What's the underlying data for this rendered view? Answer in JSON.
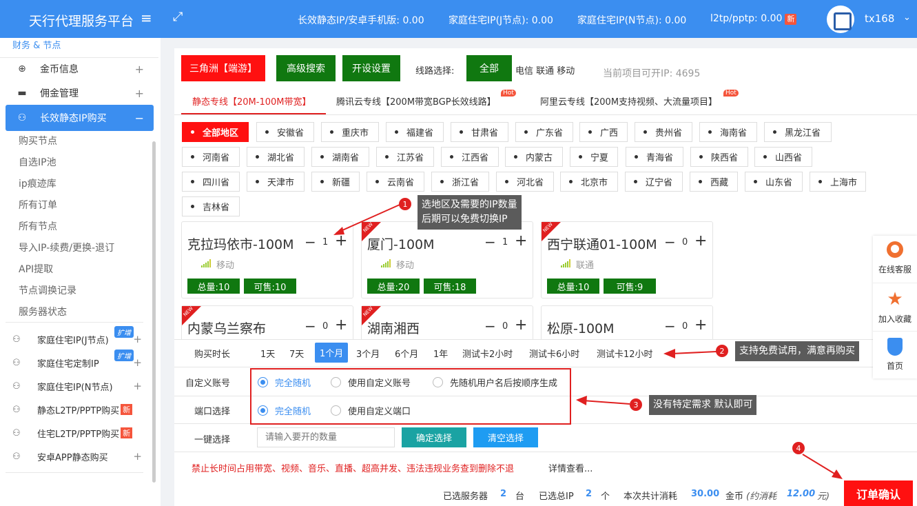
{
  "header": {
    "brand": "天行代理服务平台",
    "stats": [
      "长效静态IP/安卓手机版: 0.00",
      "家庭住宅IP(J节点): 0.00",
      "家庭住宅IP(N节点): 0.00",
      "l2tp/pptp: 0.00"
    ],
    "new_badge": "新",
    "username": "tx168"
  },
  "sidebar": {
    "top_label": "财务 & 节点",
    "gold": "金币信息",
    "commission": "佣金管理",
    "static_ip": "长效静态IP购买",
    "sub_items": [
      "购买节点",
      "自选IP池",
      "ip痕迹库",
      "所有订单",
      "所有节点",
      "导入IP-续费/更换-退订",
      "API提取",
      "节点调换记录",
      "服务器状态"
    ],
    "items2": [
      {
        "label": "家庭住宅IP(J节点)",
        "tag": "扩增"
      },
      {
        "label": "家庭住宅定制IP",
        "tag": "扩增"
      },
      {
        "label": "家庭住宅IP(N节点)",
        "tag": ""
      },
      {
        "label": "静态L2TP/PPTP购买",
        "tag": "新"
      },
      {
        "label": "住宅L2TP/PPTP购买",
        "tag": "新"
      },
      {
        "label": "安卓APP静态购买",
        "tag": ""
      }
    ]
  },
  "toolbar": {
    "sanjiaozhou": "三角洲【端游】",
    "advanced": "高级搜索",
    "settings": "开设设置",
    "line_label": "线路选择:",
    "all": "全部",
    "isps": "电信 联通 移动",
    "current": "当前项目可开IP: 4695"
  },
  "tabs": [
    {
      "label": "静态专线【20M-100M带宽】",
      "hot": ""
    },
    {
      "label": "腾讯云专线【200M带宽BGP长效线路】",
      "hot": "Hot"
    },
    {
      "label": "阿里云专线【200M支持视频、大流量项目】",
      "hot": "Hot"
    }
  ],
  "regions": [
    "全部地区",
    "安徽省",
    "重庆市",
    "福建省",
    "甘肃省",
    "广东省",
    "广西",
    "贵州省",
    "海南省",
    "黑龙江省",
    "河南省",
    "湖北省",
    "湖南省",
    "江苏省",
    "江西省",
    "内蒙古",
    "宁夏",
    "青海省",
    "陕西省",
    "山西省",
    "四川省",
    "天津市",
    "新疆",
    "云南省",
    "浙江省",
    "河北省",
    "北京市",
    "辽宁省",
    "西藏",
    "山东省",
    "上海市",
    "吉林省"
  ],
  "cards": [
    {
      "name": "克拉玛依市-100M",
      "qty": "1",
      "isp": "移动",
      "total": "总量:10",
      "sale": "可售:10",
      "new": ""
    },
    {
      "name": "厦门-100M",
      "qty": "1",
      "isp": "移动",
      "total": "总量:20",
      "sale": "可售:18",
      "new": "NEW"
    },
    {
      "name": "西宁联通01-100M",
      "qty": "0",
      "isp": "联通",
      "total": "总量:10",
      "sale": "可售:9",
      "new": "NEW"
    },
    {
      "name": "内蒙乌兰察布",
      "qty": "0",
      "isp": "",
      "total": "",
      "sale": "",
      "new": "NEW"
    },
    {
      "name": "湖南湘西",
      "qty": "0",
      "isp": "",
      "total": "",
      "sale": "",
      "new": "NEW"
    },
    {
      "name": "松原-100M",
      "qty": "0",
      "isp": "",
      "total": "",
      "sale": "",
      "new": ""
    }
  ],
  "purchase": {
    "duration_label": "购买时长",
    "durations": [
      "1天",
      "7天",
      "1个月",
      "3个月",
      "6个月",
      "1年",
      "测试卡2小时",
      "测试卡6小时",
      "测试卡12小时"
    ],
    "account_label": "自定义账号",
    "account_opts": [
      "完全随机",
      "使用自定义账号",
      "先随机用户名后按顺序生成"
    ],
    "port_label": "端口选择",
    "port_opts": [
      "完全随机",
      "使用自定义端口"
    ],
    "quick_label": "一键选择",
    "quick_placeholder": "请输入要开的数量",
    "confirm_select": "确定选择",
    "clear_select": "清空选择",
    "warning": "禁止长时间占用带宽、视频、音乐、直播、超高并发、违法违规业务查到删除不退",
    "details": "详情查看...",
    "sum_servers_label": "已选服务器",
    "sum_servers": "2",
    "sum_servers_unit": "台",
    "sum_ip_label": "已选总IP",
    "sum_ip": "2",
    "sum_ip_unit": "个",
    "cost_label": "本次共计消耗",
    "cost": "30.00",
    "coin": "金币",
    "approx": "(约消耗",
    "approx_val": "12.00",
    "approx_unit": "元)",
    "order": "订单确认"
  },
  "annotations": {
    "n1": "1",
    "t1a": "选地区及需要的IP数量",
    "t1b": "后期可以免费切换IP",
    "n2": "2",
    "t2": "支持免费试用，满意再购买",
    "n3": "3",
    "t3": "没有特定需求 默认即可",
    "n4": "4"
  },
  "float": {
    "service": "在线客服",
    "fav": "加入收藏",
    "home": "首页"
  }
}
